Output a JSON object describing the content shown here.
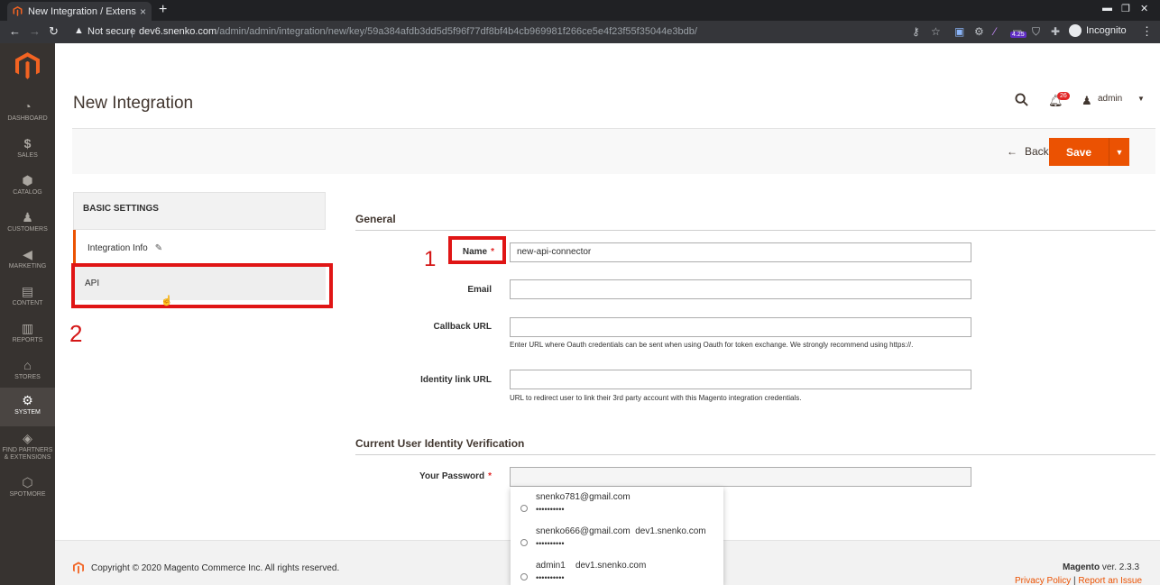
{
  "browser": {
    "tab_title": "New Integration / Extens",
    "tab_close": "×",
    "new_tab": "+",
    "not_secure": "Not secure",
    "url_host": "dev6.snenko.com",
    "url_path": "/admin/admin/integration/new/key/59a384afdb3dd5d5f96f77df8bf4b4cb969981f266ce5e4f23f55f35044e3bdb/",
    "ext_badge": "4.25",
    "incognito": "Incognito"
  },
  "sidebar": {
    "items": [
      {
        "label": "DASHBOARD",
        "icon": "dashboard-icon"
      },
      {
        "label": "SALES",
        "icon": "dollar-icon"
      },
      {
        "label": "CATALOG",
        "icon": "cube-icon"
      },
      {
        "label": "CUSTOMERS",
        "icon": "person-icon"
      },
      {
        "label": "MARKETING",
        "icon": "megaphone-icon"
      },
      {
        "label": "CONTENT",
        "icon": "layout-icon"
      },
      {
        "label": "REPORTS",
        "icon": "bar-chart-icon"
      },
      {
        "label": "STORES",
        "icon": "store-icon"
      },
      {
        "label": "SYSTEM",
        "icon": "gear-icon"
      },
      {
        "label": "FIND PARTNERS & EXTENSIONS",
        "icon": "box-icon"
      },
      {
        "label": "SPOTMORE",
        "icon": "hexagon-icon"
      }
    ]
  },
  "header": {
    "title": "New Integration",
    "notifications_count": "26",
    "user": "admin"
  },
  "actions": {
    "back": "Back",
    "save": "Save"
  },
  "tabs": {
    "heading": "BASIC SETTINGS",
    "integration_info": "Integration Info",
    "api": "API"
  },
  "annotations": {
    "one": "1",
    "two": "2"
  },
  "form": {
    "general_title": "General",
    "name_label": "Name",
    "name_value": "new-api-connector",
    "email_label": "Email",
    "callback_label": "Callback URL",
    "callback_note": "Enter URL where Oauth credentials can be sent when using Oauth for token exchange. We strongly recommend using https://.",
    "identity_label": "Identity link URL",
    "identity_note": "URL to redirect user to link their 3rd party account with this Magento integration credentials.",
    "verify_title": "Current User Identity Verification",
    "password_label": "Your Password"
  },
  "autofill": [
    {
      "user": "snenko781@gmail.com",
      "site": "",
      "pass": "••••••••••"
    },
    {
      "user": "snenko666@gmail.com",
      "site": "dev1.snenko.com",
      "pass": "••••••••••"
    },
    {
      "user": "admin1",
      "site": "dev1.snenko.com",
      "pass": "••••••••••"
    }
  ],
  "footer": {
    "copyright": "Copyright © 2020 Magento Commerce Inc. All rights reserved.",
    "brand": "Magento",
    "version": "ver. 2.3.3",
    "privacy": "Privacy Policy",
    "divider": "|",
    "report": "Report an Issue"
  },
  "colors": {
    "accent": "#eb5202",
    "sidebar": "#373330",
    "highlight": "#e01515"
  }
}
